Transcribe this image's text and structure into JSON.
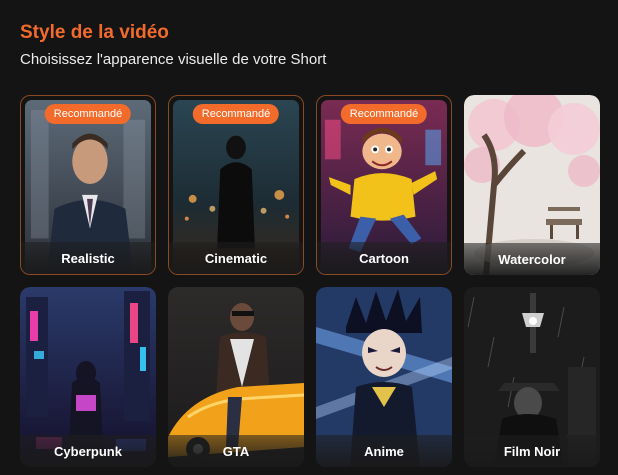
{
  "header": {
    "title": "Style de la vidéo",
    "subtitle": "Choisissez l'apparence visuelle de votre Short"
  },
  "badge_label": "Recommandé",
  "accent_color": "#f26b2a",
  "styles": [
    {
      "label": "Realistic",
      "recommended": true
    },
    {
      "label": "Cinematic",
      "recommended": true
    },
    {
      "label": "Cartoon",
      "recommended": true
    },
    {
      "label": "Watercolor",
      "recommended": false
    },
    {
      "label": "Cyberpunk",
      "recommended": false
    },
    {
      "label": "GTA",
      "recommended": false
    },
    {
      "label": "Anime",
      "recommended": false
    },
    {
      "label": "Film Noir",
      "recommended": false
    }
  ]
}
